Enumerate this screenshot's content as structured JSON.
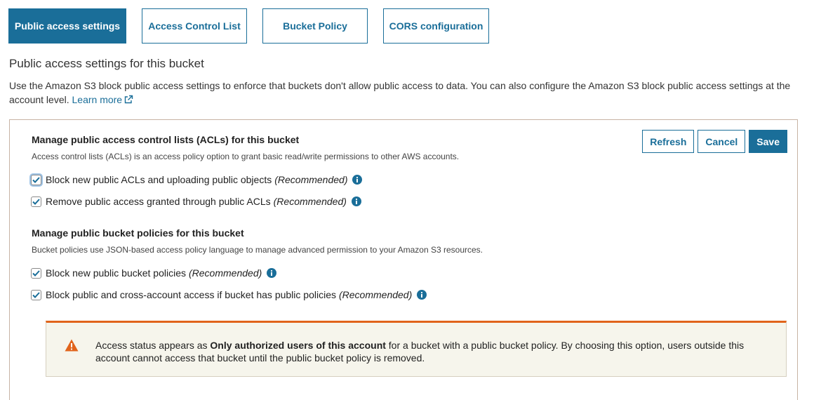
{
  "tabs": [
    {
      "label": "Public access settings",
      "active": true
    },
    {
      "label": "Access Control List",
      "active": false
    },
    {
      "label": "Bucket Policy",
      "active": false
    },
    {
      "label": "CORS configuration",
      "active": false
    }
  ],
  "page": {
    "title": "Public access settings for this bucket",
    "description": "Use the Amazon S3 block public access settings to enforce that buckets don't allow public access to data. You can also configure the Amazon S3 block public access settings at the account level.",
    "learn_more": "Learn more"
  },
  "actions": {
    "refresh": "Refresh",
    "cancel": "Cancel",
    "save": "Save"
  },
  "acl_section": {
    "title": "Manage public access control lists (ACLs) for this bucket",
    "subtitle": "Access control lists (ACLs) is an access policy option to grant basic read/write permissions to other AWS accounts.",
    "options": [
      {
        "label": "Block new public ACLs and uploading public objects",
        "tag": "(Recommended)",
        "checked": true
      },
      {
        "label": "Remove public access granted through public ACLs",
        "tag": "(Recommended)",
        "checked": true
      }
    ]
  },
  "policy_section": {
    "title": "Manage public bucket policies for this bucket",
    "subtitle": "Bucket policies use JSON-based access policy language to manage advanced permission to your Amazon S3 resources.",
    "options": [
      {
        "label": "Block new public bucket policies",
        "tag": "(Recommended)",
        "checked": true
      },
      {
        "label": "Block public and cross-account access if bucket has public policies",
        "tag": "(Recommended)",
        "checked": true
      }
    ]
  },
  "warning": {
    "text_before": "Access status appears as ",
    "text_bold": "Only authorized users of this account",
    "text_after": " for a bucket with a public bucket policy. By choosing this option, users outside this account cannot access that bucket until the public bucket policy is removed."
  },
  "colors": {
    "accent": "#1a6e99",
    "warning": "#e1641c",
    "info": "#1a6e99"
  }
}
